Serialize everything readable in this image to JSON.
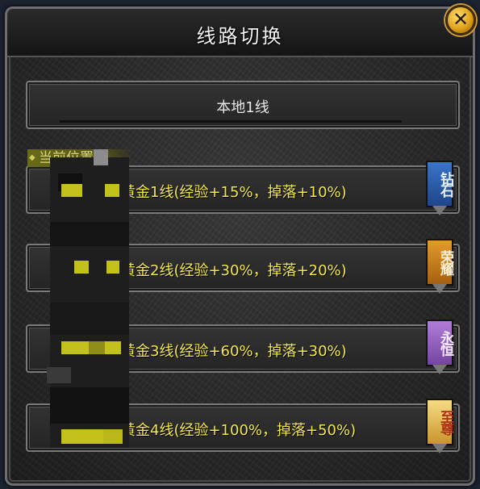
{
  "title": "线路切换",
  "close_icon": "close-icon",
  "local_line": {
    "label": "本地1线"
  },
  "current_position_label": "当前位置",
  "gold_lines": [
    {
      "label": "黄金1线(经验+15%，掉落+10%)",
      "badge": "钻石",
      "badge_color": "#2e5fae"
    },
    {
      "label": "黄金2线(经验+30%，掉落+20%)",
      "badge": "荣耀",
      "badge_color": "#c8801f"
    },
    {
      "label": "黄金3线(经验+60%，掉落+30%)",
      "badge": "永恒",
      "badge_color": "#9a62c4"
    },
    {
      "label": "黄金4线(经验+100%，掉落+50%)",
      "badge": "至尊",
      "badge_color": "#e9c257"
    }
  ],
  "colors": {
    "gold_text": "#f2e84a",
    "title_text": "#f2f2f2"
  }
}
